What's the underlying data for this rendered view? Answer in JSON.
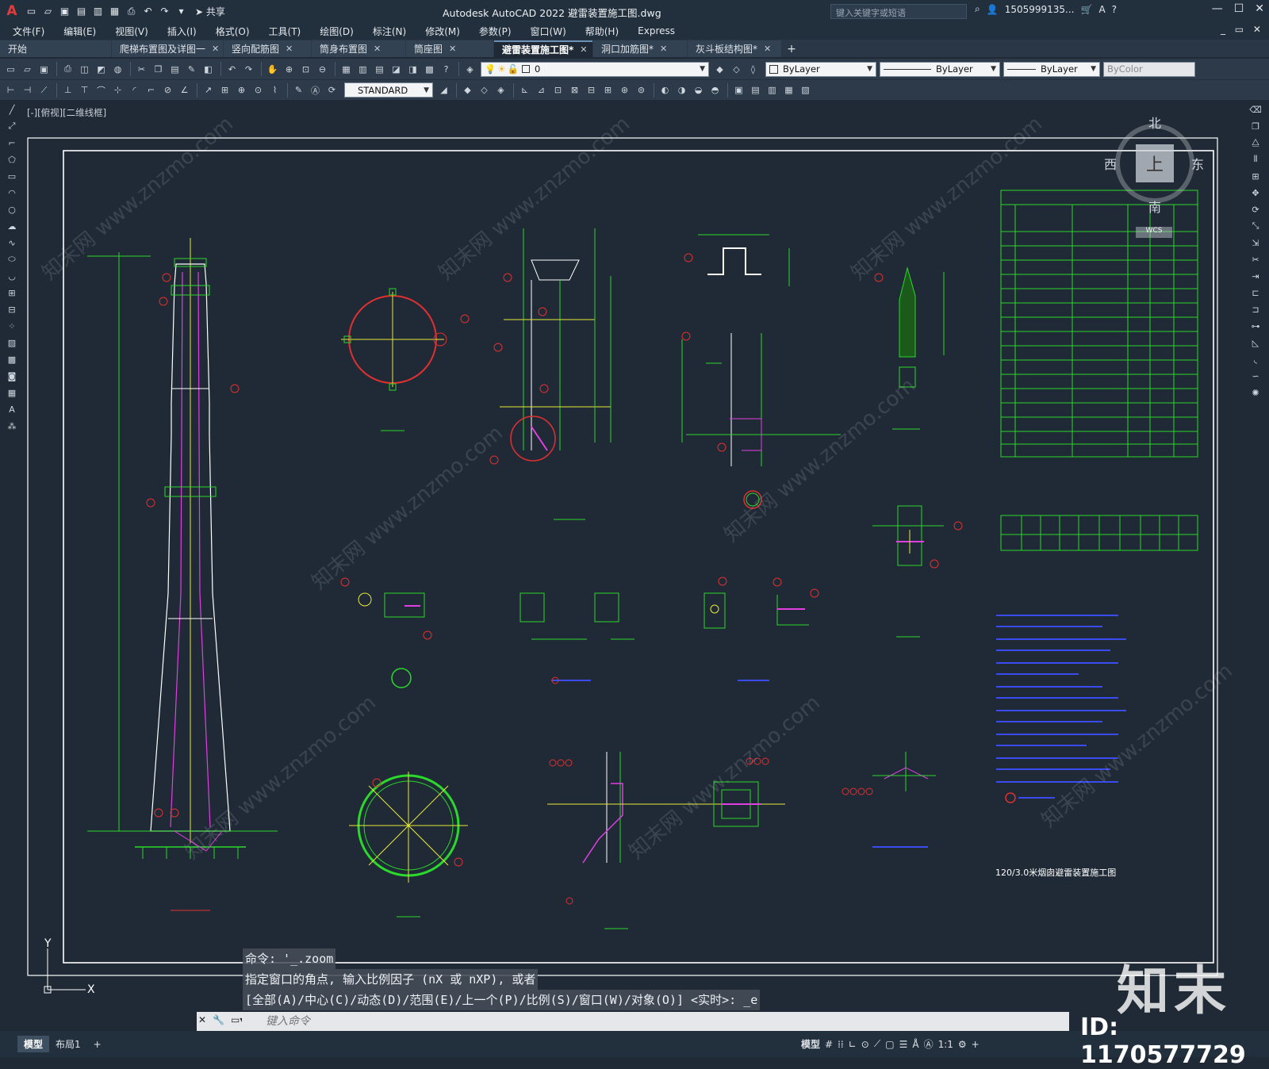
{
  "app": {
    "logo": "A",
    "title": "Autodesk AutoCAD 2022    避雷装置施工图.dwg",
    "share_label": "共享",
    "search_placeholder": "键入关键字或短语",
    "user": "1505999135...",
    "window_controls": [
      "—",
      "☐",
      "✕"
    ]
  },
  "menu": [
    "文件(F)",
    "编辑(E)",
    "视图(V)",
    "插入(I)",
    "格式(O)",
    "工具(T)",
    "绘图(D)",
    "标注(N)",
    "修改(M)",
    "参数(P)",
    "窗口(W)",
    "帮助(H)",
    "Express"
  ],
  "tabs": [
    {
      "label": "开始",
      "active": false
    },
    {
      "label": "爬梯布置图及详图一",
      "active": false
    },
    {
      "label": "竖向配筋图",
      "active": false
    },
    {
      "label": "筒身布置图",
      "active": false
    },
    {
      "label": "筒座图",
      "active": false
    },
    {
      "label": "避雷装置施工图*",
      "active": true
    },
    {
      "label": "洞口加筋图*",
      "active": false
    },
    {
      "label": "灰斗板结构图*",
      "active": false
    }
  ],
  "properties": {
    "layer": "0",
    "color": "ByLayer",
    "linetype": "ByLayer",
    "lineweight": "ByLayer",
    "plotstyle": "ByColor",
    "textstyle": "STANDARD"
  },
  "viewport": {
    "label": "[-][俯视][二维线框]",
    "compass": {
      "north": "北",
      "south": "南",
      "east": "东",
      "west": "西",
      "top": "上",
      "ucs": "WCS"
    },
    "drawing_title": "120/3.0米烟囱避雷装置施工图"
  },
  "command": {
    "history": [
      "命令: '_.zoom",
      "指定窗口的角点, 输入比例因子 (nX 或 nXP), 或者",
      "[全部(A)/中心(C)/动态(D)/范围(E)/上一个(P)/比例(S)/窗口(W)/对象(O)] <实时>: _e"
    ],
    "placeholder": "键入命令"
  },
  "status": {
    "layout_tabs": [
      "模型",
      "布局1"
    ],
    "model_label": "模型",
    "scale": "1:1"
  },
  "watermark": {
    "logo": "知末",
    "id": "ID: 1170577729",
    "site": "知末网 www.znzmo.com"
  }
}
